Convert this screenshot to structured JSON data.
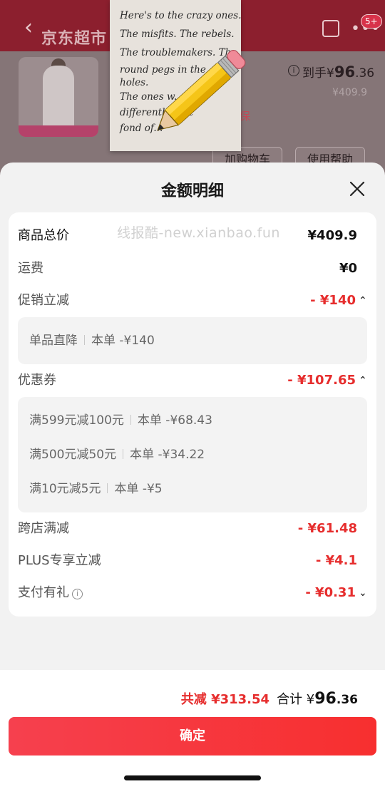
{
  "background_page": {
    "back_glyph": "‹",
    "title": "京东超市",
    "more_glyph": "•••",
    "badge": "5+",
    "product_name": "",
    "info_glyph": "i",
    "arrive_label": "到手¥",
    "arrive_int": "96",
    "arrive_dec": ".36",
    "original_price": "¥409.9",
    "tag": "保",
    "add_cart": "加购物车",
    "help": "使用帮助"
  },
  "note": {
    "lines": [
      "Here's to the crazy ones.",
      "The misfits. The rebels.",
      "The troublemakers. The",
      "round pegs in the",
      "holes.",
      "The ones w...",
      "differentl... not",
      "fond of..."
    ]
  },
  "sheet": {
    "title": "金额明细",
    "watermark": "线报酷-new.xianbao.fun",
    "rows": {
      "goods_total": {
        "label": "商品总价",
        "value": "¥409.9"
      },
      "shipping": {
        "label": "运费",
        "value": "¥0"
      },
      "promo": {
        "label": "促销立减",
        "value": "- ¥140",
        "chevron": "⌃"
      },
      "coupon": {
        "label": "优惠券",
        "value": "- ¥107.65",
        "chevron": "⌃"
      },
      "cross_store": {
        "label": "跨店满减",
        "value": "- ¥61.48"
      },
      "plus": {
        "label": "PLUS专享立减",
        "value": "- ¥4.1"
      },
      "pay_gift": {
        "label": "支付有礼",
        "info": "i",
        "value": "- ¥0.31",
        "chevron": "⌄"
      }
    },
    "promo_detail": [
      {
        "name": "单品直降",
        "amount": "本单 -¥140"
      }
    ],
    "coupon_detail": [
      {
        "name": "满599元减100元",
        "amount": "本单 -¥68.43"
      },
      {
        "name": "满500元减50元",
        "amount": "本单 -¥34.22"
      },
      {
        "name": "满10元减5元",
        "amount": "本单 -¥5"
      }
    ],
    "footer": {
      "total_reduce": "共减 ¥313.54",
      "sum_label": "合计 ¥",
      "sum_int": "96",
      "sum_dec": ".36",
      "confirm": "确定"
    }
  }
}
